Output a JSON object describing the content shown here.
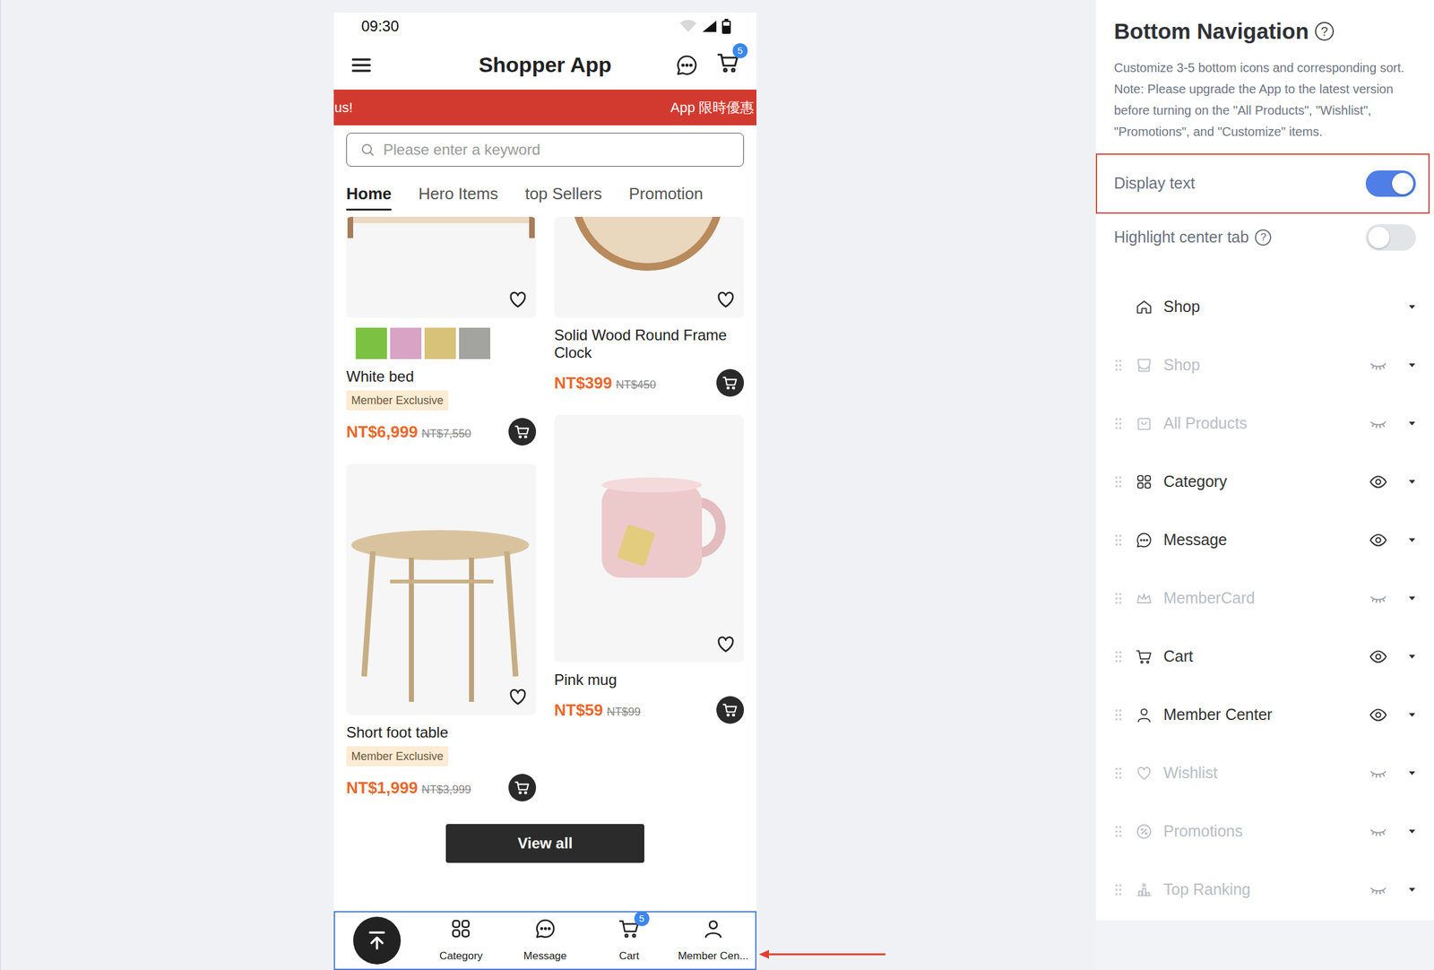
{
  "phone": {
    "status_bar": {
      "time": "09:30"
    },
    "header": {
      "title": "Shopper App",
      "cart_badge": "5"
    },
    "banner": {
      "texts": [
        "us!",
        "App 限時優惠"
      ]
    },
    "search": {
      "placeholder": "Please enter a keyword"
    },
    "tabs": [
      {
        "label": "Home",
        "selected": true
      },
      {
        "label": "Hero Items",
        "selected": false
      },
      {
        "label": "top Sellers",
        "selected": false
      },
      {
        "label": "Promotion",
        "selected": false
      }
    ],
    "product_columns": [
      [
        {
          "title": "White bed",
          "badge": "Member Exclusive",
          "price": "NT$6,999",
          "old_price": "NT$7,550",
          "swatches": [
            {
              "color": "#7cc242"
            },
            {
              "color": "#d9a3c6"
            },
            {
              "color": "#d8c27a"
            },
            {
              "color": "#a3a3a0"
            }
          ]
        },
        {
          "title": "Short foot table",
          "badge": "Member Exclusive",
          "price": "NT$1,999",
          "old_price": "NT$3,999",
          "swatches": []
        }
      ],
      [
        {
          "title": "Solid Wood Round Frame Clock",
          "badge": "",
          "price": "NT$399",
          "old_price": "NT$450",
          "swatches": []
        },
        {
          "title": "Pink mug",
          "badge": "",
          "price": "NT$59",
          "old_price": "NT$99",
          "swatches": []
        }
      ]
    ],
    "view_all": "View all",
    "bottom_nav": [
      {
        "kind": "scroll-top",
        "label": "",
        "badge": ""
      },
      {
        "kind": "tab",
        "label": "Category",
        "badge": ""
      },
      {
        "kind": "tab",
        "label": "Message",
        "badge": ""
      },
      {
        "kind": "tab",
        "label": "Cart",
        "badge": "5"
      },
      {
        "kind": "tab",
        "label": "Member Cen...",
        "badge": ""
      }
    ]
  },
  "panel": {
    "title": "Bottom Navigation",
    "title_help": "?",
    "description": "Customize 3-5 bottom icons and corresponding sort. Note: Please upgrade the App to the latest version before turning on the \"All Products\", \"Wishlist\", \"Promotions\", and \"Customize\" items.",
    "settings": [
      {
        "label": "Display text",
        "on": true,
        "highlighted": true,
        "help": ""
      },
      {
        "label": "Highlight center tab",
        "on": false,
        "highlighted": false,
        "help": "?"
      }
    ],
    "items": [
      {
        "label": "Shop",
        "kind": "fixed",
        "visible": true
      },
      {
        "label": "Shop",
        "kind": "sortable",
        "visible": false
      },
      {
        "label": "All Products",
        "kind": "sortable",
        "visible": false
      },
      {
        "label": "Category",
        "kind": "sortable",
        "visible": true
      },
      {
        "label": "Message",
        "kind": "sortable",
        "visible": true
      },
      {
        "label": "MemberCard",
        "kind": "sortable",
        "visible": false
      },
      {
        "label": "Cart",
        "kind": "sortable",
        "visible": true
      },
      {
        "label": "Member Center",
        "kind": "sortable",
        "visible": true
      },
      {
        "label": "Wishlist",
        "kind": "sortable",
        "visible": false
      },
      {
        "label": "Promotions",
        "kind": "sortable",
        "visible": false
      },
      {
        "label": "Top Ranking",
        "kind": "sortable",
        "visible": false
      }
    ]
  }
}
